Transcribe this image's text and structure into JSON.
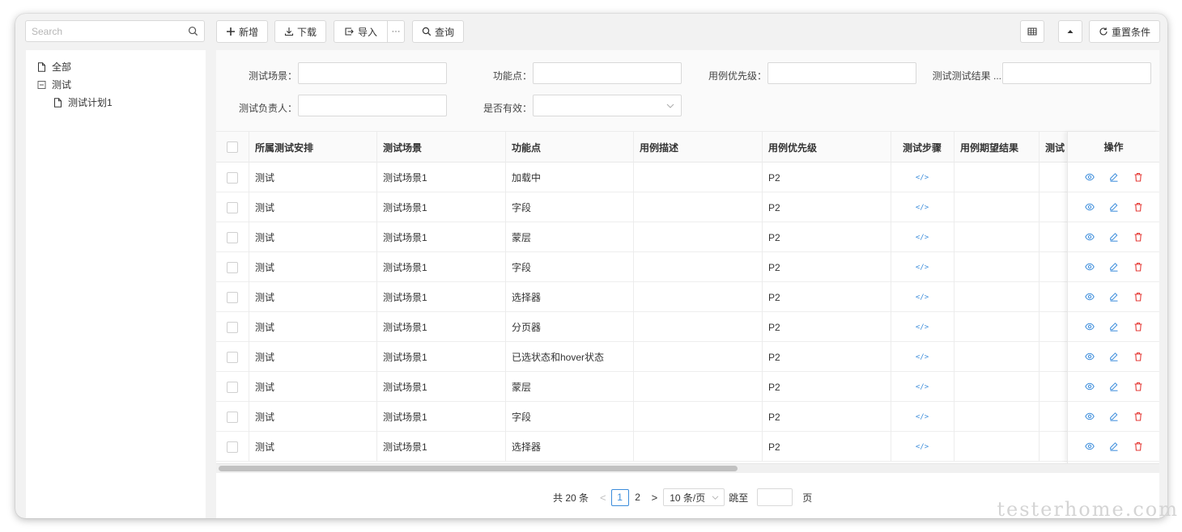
{
  "toolbar": {
    "search_placeholder": "Search",
    "add_label": "新增",
    "download_label": "下载",
    "import_label": "导入",
    "more_label": "···",
    "query_label": "查询",
    "reset_label": "重置条件"
  },
  "tree": {
    "items": [
      {
        "label": "全部"
      },
      {
        "label": "测试"
      },
      {
        "label": "测试计划1"
      }
    ]
  },
  "filters": {
    "scene_label": "测试场景：",
    "feature_label": "功能点：",
    "priority_label": "用例优先级：",
    "result_label": "测试测试结果 ...",
    "owner_label": "测试负责人：",
    "valid_label": "是否有效："
  },
  "table": {
    "headers": [
      "所属测试安排",
      "测试场景",
      "功能点",
      "用例描述",
      "用例优先级",
      "测试步骤",
      "用例期望结果",
      "测试",
      "操作"
    ],
    "rows": [
      {
        "plan": "测试",
        "scene": "测试场景1",
        "feature": "加载中",
        "desc": "",
        "priority": "P2"
      },
      {
        "plan": "测试",
        "scene": "测试场景1",
        "feature": "字段",
        "desc": "",
        "priority": "P2"
      },
      {
        "plan": "测试",
        "scene": "测试场景1",
        "feature": "蒙层",
        "desc": "",
        "priority": "P2"
      },
      {
        "plan": "测试",
        "scene": "测试场景1",
        "feature": "字段",
        "desc": "",
        "priority": "P2"
      },
      {
        "plan": "测试",
        "scene": "测试场景1",
        "feature": "选择器",
        "desc": "",
        "priority": "P2"
      },
      {
        "plan": "测试",
        "scene": "测试场景1",
        "feature": "分页器",
        "desc": "",
        "priority": "P2"
      },
      {
        "plan": "测试",
        "scene": "测试场景1",
        "feature": "已选状态和hover状态",
        "desc": "",
        "priority": "P2"
      },
      {
        "plan": "测试",
        "scene": "测试场景1",
        "feature": "蒙层",
        "desc": "",
        "priority": "P2"
      },
      {
        "plan": "测试",
        "scene": "测试场景1",
        "feature": "字段",
        "desc": "",
        "priority": "P2"
      },
      {
        "plan": "测试",
        "scene": "测试场景1",
        "feature": "选择器",
        "desc": "",
        "priority": "P2"
      }
    ],
    "code_icon_text": "</>"
  },
  "pagination": {
    "total": "共 20 条",
    "pages": [
      "1",
      "2"
    ],
    "current": "1",
    "page_size": "10 条/页",
    "jump_label": "跳至",
    "page_suffix": "页"
  },
  "colors": {
    "accent": "#3b8cdb",
    "danger": "#e53935"
  },
  "watermark": "testerhome.com"
}
